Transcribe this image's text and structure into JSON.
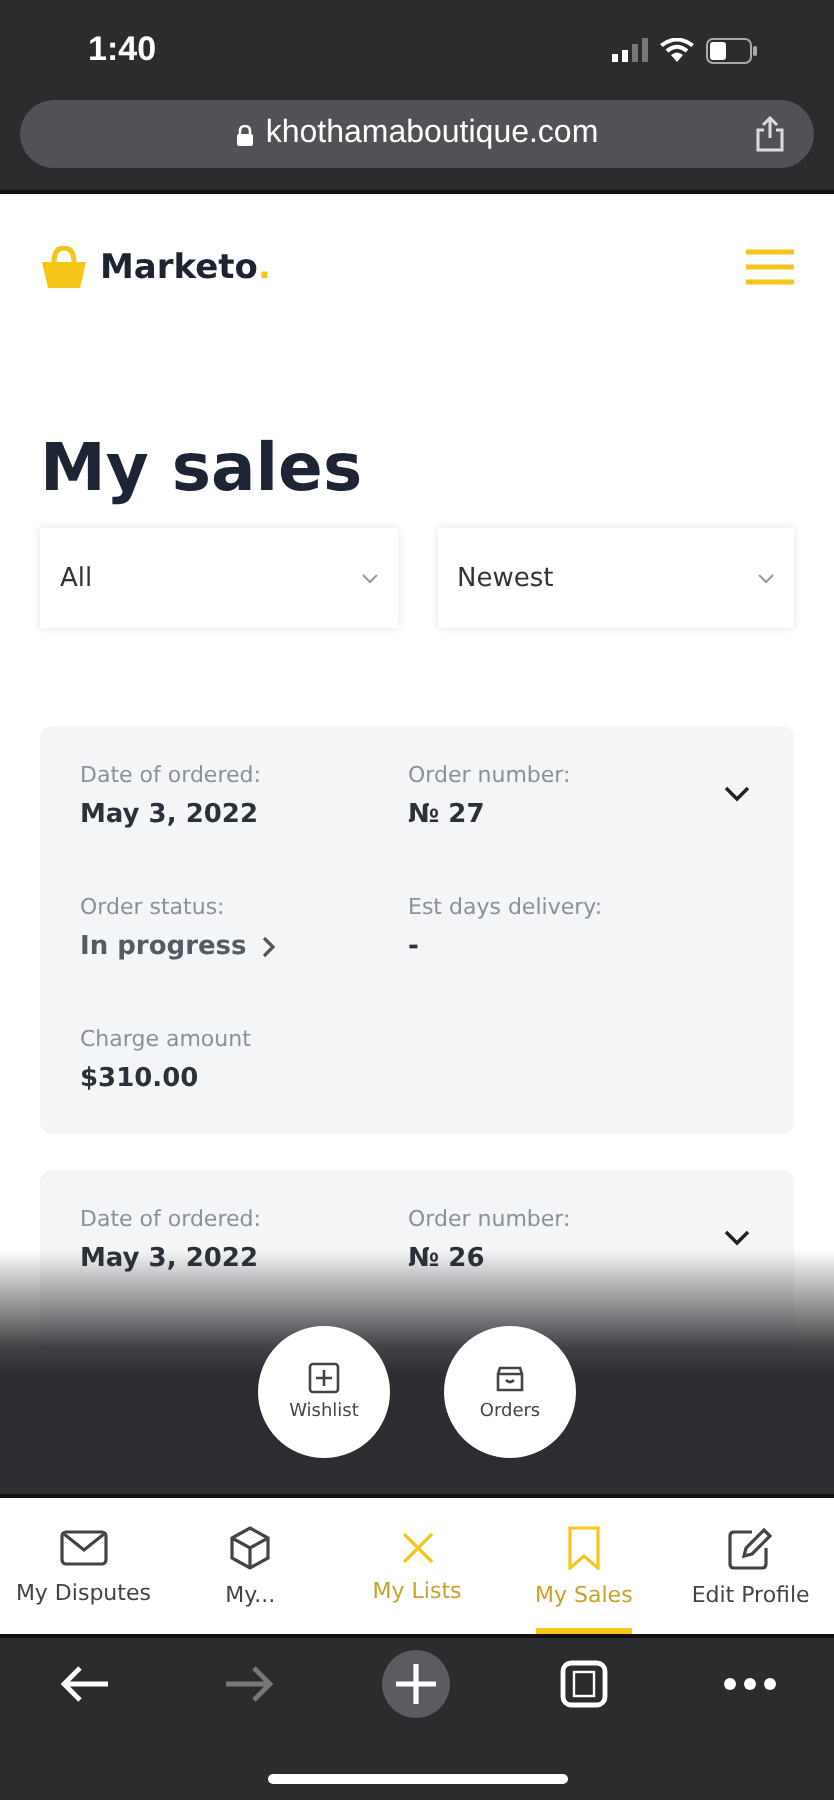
{
  "status_bar": {
    "time": "1:40"
  },
  "browser": {
    "url": "khothamaboutique.com"
  },
  "header": {
    "logo_text": "Marketo",
    "logo_dot": "."
  },
  "title": "My sales",
  "filters": [
    {
      "value": "All"
    },
    {
      "value": "Newest"
    }
  ],
  "orders": [
    {
      "fields": [
        {
          "label": "Date of ordered:",
          "value": "May 3, 2022"
        },
        {
          "label": "Order number:",
          "value": "№ 27"
        },
        {
          "label": "Order status:",
          "value": "In progress",
          "kind": "link"
        },
        {
          "label": "Est days delivery:",
          "value": "-"
        },
        {
          "label": "Charge amount",
          "value": "$310.00"
        }
      ]
    },
    {
      "fields": [
        {
          "label": "Date of ordered:",
          "value": "May 3, 2022"
        },
        {
          "label": "Order number:",
          "value": "№ 26"
        }
      ]
    }
  ],
  "quick_actions": [
    {
      "label": "Wishlist",
      "kind": "add"
    },
    {
      "label": "Orders",
      "kind": "bag"
    }
  ],
  "tabs": [
    {
      "label": "My Disputes",
      "kind": "mail",
      "selected": false,
      "highlighted": false
    },
    {
      "label": "My...",
      "kind": "box",
      "selected": false,
      "highlighted": false
    },
    {
      "label": "My Lists",
      "kind": "cross",
      "selected": false,
      "highlighted": true
    },
    {
      "label": "My Sales",
      "kind": "bookmark",
      "selected": true,
      "highlighted": true
    },
    {
      "label": "Edit Profile",
      "kind": "edit",
      "selected": false,
      "highlighted": false
    }
  ]
}
